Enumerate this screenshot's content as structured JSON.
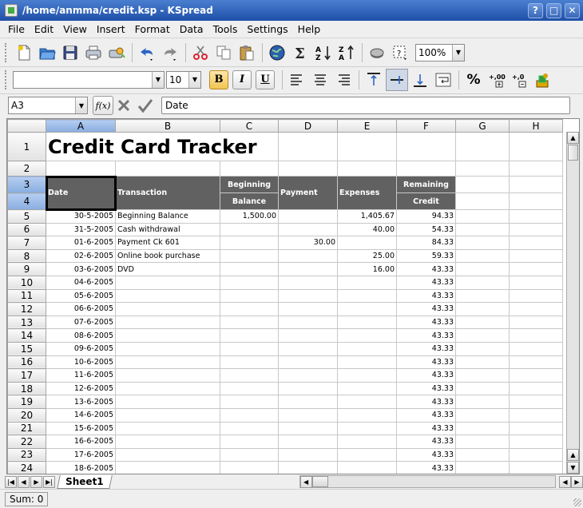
{
  "window": {
    "title": "/home/anmma/credit.ksp - KSpread",
    "buttons": [
      "?",
      "□",
      "✕"
    ]
  },
  "menu": [
    "File",
    "Edit",
    "View",
    "Insert",
    "Format",
    "Data",
    "Tools",
    "Settings",
    "Help"
  ],
  "toolbar1": {
    "zoom": "100%",
    "icons": [
      "new-document-icon",
      "open-folder-icon",
      "save-icon",
      "print-icon",
      "print-preview-icon",
      "undo-icon",
      "redo-icon",
      "cut-icon",
      "copy-icon",
      "paste-icon",
      "web-globe-icon",
      "sum-icon",
      "sort-ascending-icon",
      "sort-descending-icon",
      "insert-chart-icon",
      "select-icon"
    ]
  },
  "toolbar2": {
    "font_family": "",
    "font_size": "10",
    "bold": "B",
    "italic": "I",
    "underline": "U",
    "percent": "%"
  },
  "formula_bar": {
    "cell_ref": "A3",
    "fx": "f(x)",
    "content": "Date"
  },
  "columns": [
    "A",
    "B",
    "C",
    "D",
    "E",
    "F",
    "G",
    "H"
  ],
  "selected_column": "A",
  "spreadsheet": {
    "title": "Credit Card Tracker",
    "headers": {
      "date": "Date",
      "transaction": "Transaction",
      "beginning": "Beginning",
      "balance": "Balance",
      "payment": "Payment",
      "expenses": "Expenses",
      "remaining": "Remaining",
      "credit": "Credit"
    },
    "rows": [
      {
        "row": "5",
        "date": "30-5-2005",
        "transaction": "Beginning Balance",
        "beginning": "1,500.00",
        "payment": "",
        "expenses": "1,405.67",
        "remaining": "94.33"
      },
      {
        "row": "6",
        "date": "31-5-2005",
        "transaction": "Cash withdrawal",
        "beginning": "",
        "payment": "",
        "expenses": "40.00",
        "remaining": "54.33"
      },
      {
        "row": "7",
        "date": "01-6-2005",
        "transaction": "Payment Ck 601",
        "beginning": "",
        "payment": "30.00",
        "expenses": "",
        "remaining": "84.33"
      },
      {
        "row": "8",
        "date": "02-6-2005",
        "transaction": "Online book purchase",
        "beginning": "",
        "payment": "",
        "expenses": "25.00",
        "remaining": "59.33"
      },
      {
        "row": "9",
        "date": "03-6-2005",
        "transaction": "DVD",
        "beginning": "",
        "payment": "",
        "expenses": "16.00",
        "remaining": "43.33"
      },
      {
        "row": "10",
        "date": "04-6-2005",
        "transaction": "",
        "beginning": "",
        "payment": "",
        "expenses": "",
        "remaining": "43.33"
      },
      {
        "row": "11",
        "date": "05-6-2005",
        "transaction": "",
        "beginning": "",
        "payment": "",
        "expenses": "",
        "remaining": "43.33"
      },
      {
        "row": "12",
        "date": "06-6-2005",
        "transaction": "",
        "beginning": "",
        "payment": "",
        "expenses": "",
        "remaining": "43.33"
      },
      {
        "row": "13",
        "date": "07-6-2005",
        "transaction": "",
        "beginning": "",
        "payment": "",
        "expenses": "",
        "remaining": "43.33"
      },
      {
        "row": "14",
        "date": "08-6-2005",
        "transaction": "",
        "beginning": "",
        "payment": "",
        "expenses": "",
        "remaining": "43.33"
      },
      {
        "row": "15",
        "date": "09-6-2005",
        "transaction": "",
        "beginning": "",
        "payment": "",
        "expenses": "",
        "remaining": "43.33"
      },
      {
        "row": "16",
        "date": "10-6-2005",
        "transaction": "",
        "beginning": "",
        "payment": "",
        "expenses": "",
        "remaining": "43.33"
      },
      {
        "row": "17",
        "date": "11-6-2005",
        "transaction": "",
        "beginning": "",
        "payment": "",
        "expenses": "",
        "remaining": "43.33"
      },
      {
        "row": "18",
        "date": "12-6-2005",
        "transaction": "",
        "beginning": "",
        "payment": "",
        "expenses": "",
        "remaining": "43.33"
      },
      {
        "row": "19",
        "date": "13-6-2005",
        "transaction": "",
        "beginning": "",
        "payment": "",
        "expenses": "",
        "remaining": "43.33"
      },
      {
        "row": "20",
        "date": "14-6-2005",
        "transaction": "",
        "beginning": "",
        "payment": "",
        "expenses": "",
        "remaining": "43.33"
      },
      {
        "row": "21",
        "date": "15-6-2005",
        "transaction": "",
        "beginning": "",
        "payment": "",
        "expenses": "",
        "remaining": "43.33"
      },
      {
        "row": "22",
        "date": "16-6-2005",
        "transaction": "",
        "beginning": "",
        "payment": "",
        "expenses": "",
        "remaining": "43.33"
      },
      {
        "row": "23",
        "date": "17-6-2005",
        "transaction": "",
        "beginning": "",
        "payment": "",
        "expenses": "",
        "remaining": "43.33"
      },
      {
        "row": "24",
        "date": "18-6-2005",
        "transaction": "",
        "beginning": "",
        "payment": "",
        "expenses": "",
        "remaining": "43.33"
      }
    ]
  },
  "sheet_tab": "Sheet1",
  "status": "Sum: 0",
  "colors": {
    "header_fill": "#616161",
    "selection": "#88aee0",
    "titlebar": "#2d5fb6"
  }
}
